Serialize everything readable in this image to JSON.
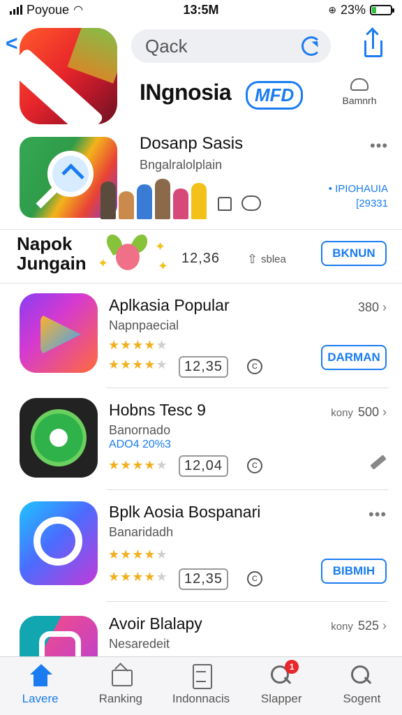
{
  "status_bar": {
    "carrier": "Poyoue",
    "time": "13:5M",
    "battery_text": "23%",
    "battery_level": 0.23
  },
  "header": {
    "search_placeholder": "Qack",
    "brand_title": "INgnosia",
    "brand_badge": "MFD",
    "favorite_label": "Bamnrh"
  },
  "featured": {
    "title": "Dosanp Sasis",
    "subtitle": "Bngalralolplain",
    "right_line1": "• IPIOHAUIA",
    "right_line2": "[29331"
  },
  "section": {
    "title_line1": "Napok",
    "title_line2": "Jungain",
    "number": "12,36",
    "small_text": "sblea",
    "button_label": "BKNUN"
  },
  "apps": [
    {
      "name": "Aplkasia Popular",
      "subtitle": "Napnpaecial",
      "extra": "",
      "rating_stars": 4,
      "number": "12,35",
      "circle": "C",
      "right_prefix": "",
      "right_value": "380",
      "button_label": "DARMAN"
    },
    {
      "name": "Hobns Tesc 9",
      "subtitle": "Banornado",
      "extra": "ADO4 20%3",
      "rating_stars": 4,
      "number": "12,04",
      "circle": "C",
      "right_prefix": "kony",
      "right_value": "500",
      "button_label": ""
    },
    {
      "name": "Bplk Aosia Bospanari",
      "subtitle": "Banaridadh",
      "extra": "",
      "rating_stars": 4,
      "number": "12,35",
      "circle": "C",
      "right_prefix": "",
      "right_value": "",
      "button_label": "BIBMIH"
    },
    {
      "name": "Avoir Blalapy",
      "subtitle": "Nesaredeit",
      "extra": "",
      "rating_stars": 0,
      "number": "",
      "circle": "",
      "right_prefix": "kony",
      "right_value": "525",
      "button_label": ""
    }
  ],
  "tabs": [
    {
      "label": "Lavere",
      "icon": "home-icon",
      "active": true
    },
    {
      "label": "Ranking",
      "icon": "ranking-icon",
      "active": false
    },
    {
      "label": "Indonnacis",
      "icon": "document-icon",
      "active": false
    },
    {
      "label": "Slapper",
      "icon": "search-icon",
      "active": false,
      "badge": "1"
    },
    {
      "label": "Sogent",
      "icon": "search-icon",
      "active": false
    }
  ]
}
